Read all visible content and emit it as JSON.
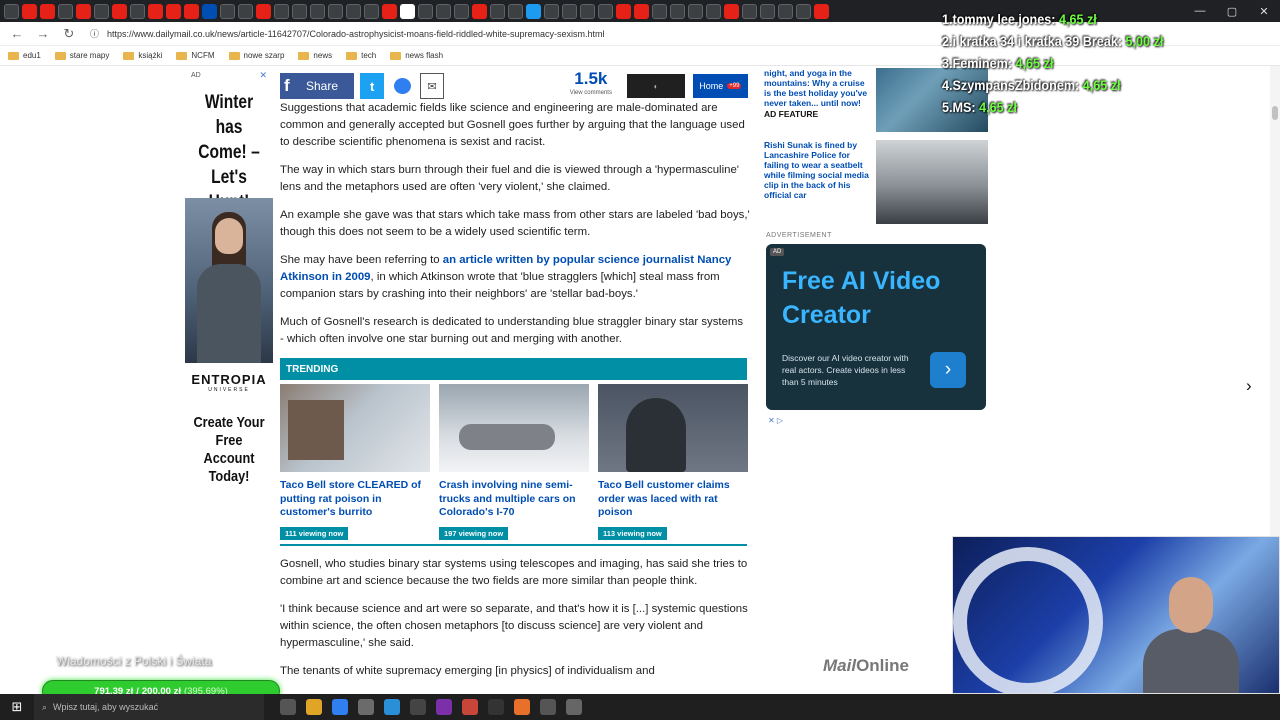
{
  "browser": {
    "url": "https://www.dailymail.co.uk/news/article-11642707/Colorado-astrophysicist-moans-field-riddled-white-supremacy-sexism.html",
    "bookmarks": [
      "edu1",
      "stare mapy",
      "książki",
      "NCFM",
      "nowe szarp",
      "news",
      "tech",
      "news flash"
    ],
    "window_controls": [
      "—",
      "▢",
      "✕"
    ]
  },
  "left_ad": {
    "ad_tag": "AD",
    "close": "✕",
    "headline": "Winter has Come! – Let's Hunt!",
    "brand": "ENTROPIA",
    "brand_sub": "UNIVERSE",
    "cta": "Create Your Free Account Today!"
  },
  "share_bar": {
    "share_label": "Share",
    "comment_count": "1.5k",
    "comment_label": "View comments",
    "home_label": "Home",
    "home_badge": "+99"
  },
  "article": {
    "paragraphs": [
      "Suggestions that academic fields like science and engineering are male-dominated are common and generally accepted but Gosnell goes further by arguing that the language used to describe scientific phenomena is sexist and racist.",
      "The way in which stars burn through their fuel and die is viewed through a 'hypermasculine' lens and the metaphors used are often 'very violent,' she claimed.",
      "An example she gave was that stars which take mass from other stars are labeled 'bad boys,' though this does not seem to be a widely used scientific term."
    ],
    "p4_pre": "She may have been referring to ",
    "p4_link": "an article written by popular science journalist Nancy Atkinson in 2009",
    "p4_post": ", in which Atkinson wrote that 'blue stragglers [which] steal mass from companion stars by crashing into their neighbors' are 'stellar bad-boys.'",
    "p5": "Much of Gosnell's research is dedicated to understanding blue straggler binary star systems - which often involve one star burning out and merging with another.",
    "after": [
      "Gosnell, who studies binary star systems using telescopes and imaging, has said she tries to combine art and science because the two fields are more similar than people think.",
      "'I think because science and art were so separate, and that's how it is [...] systemic questions within science, the often chosen metaphors [to discuss science] are very violent and hypermasculine,' she said.",
      "The tenants of white supremacy emerging [in physics] of individualism and"
    ]
  },
  "trending": {
    "header": "TRENDING",
    "cards": [
      {
        "title": "Taco Bell store CLEARED of putting rat poison in customer's burrito",
        "views": "111 viewing now"
      },
      {
        "title": "Crash involving nine semi-trucks and multiple cars on Colorado's I-70",
        "views": "197 viewing now"
      },
      {
        "title": "Taco Bell customer claims order was laced with rat poison",
        "views": "113 viewing now"
      }
    ]
  },
  "sidebar": {
    "item1_text": "night, and yoga in the mountains: Why a cruise is the best holiday you've never taken... until now!",
    "item1_label": "AD FEATURE",
    "item2_text": "Rishi Sunak is fined by Lancashire Police for failing to wear a seatbelt while filming social media clip in the back of his official car",
    "adv_label": "ADVERTISEMENT",
    "ai_ad_tag": "AD",
    "ai_ad_headline": "Free AI Video Creator",
    "ai_ad_sub": "Discover our AI video creator with real actors. Create videos in less than 5 minutes",
    "ai_ad_arrow": "›",
    "ad_controls": "✕ ▷",
    "mailonline": "Mail",
    "mailonline_b": "Online",
    "next_arrow": "›"
  },
  "stream": {
    "donors": [
      {
        "name": "1.tommy lee jones:",
        "amount": "4,65 zł"
      },
      {
        "name": "2.i kratka 34 i kratka 39 Break:",
        "amount": "5,00 zł"
      },
      {
        "name": "3.Feminem:",
        "amount": "4,65 zł"
      },
      {
        "name": "4.SzympansZbidonem:",
        "amount": "4,65 zł"
      },
      {
        "name": "5.MS:",
        "amount": "4,65 zł"
      }
    ],
    "channel": "Wiadomości z Polski i Świata",
    "goal_current": "791,39 zł",
    "goal_sep": "/",
    "goal_target": "200,00 zł",
    "goal_pct": "(395,69%)"
  },
  "taskbar": {
    "start": "⊞",
    "search_placeholder": "Wpisz tutaj, aby wyszukać"
  },
  "colors": {
    "brand_blue": "#004db3",
    "trending_teal": "#008fa5",
    "ai_ad_bg": "#17313d",
    "goal_green": "#2fcc2f"
  }
}
